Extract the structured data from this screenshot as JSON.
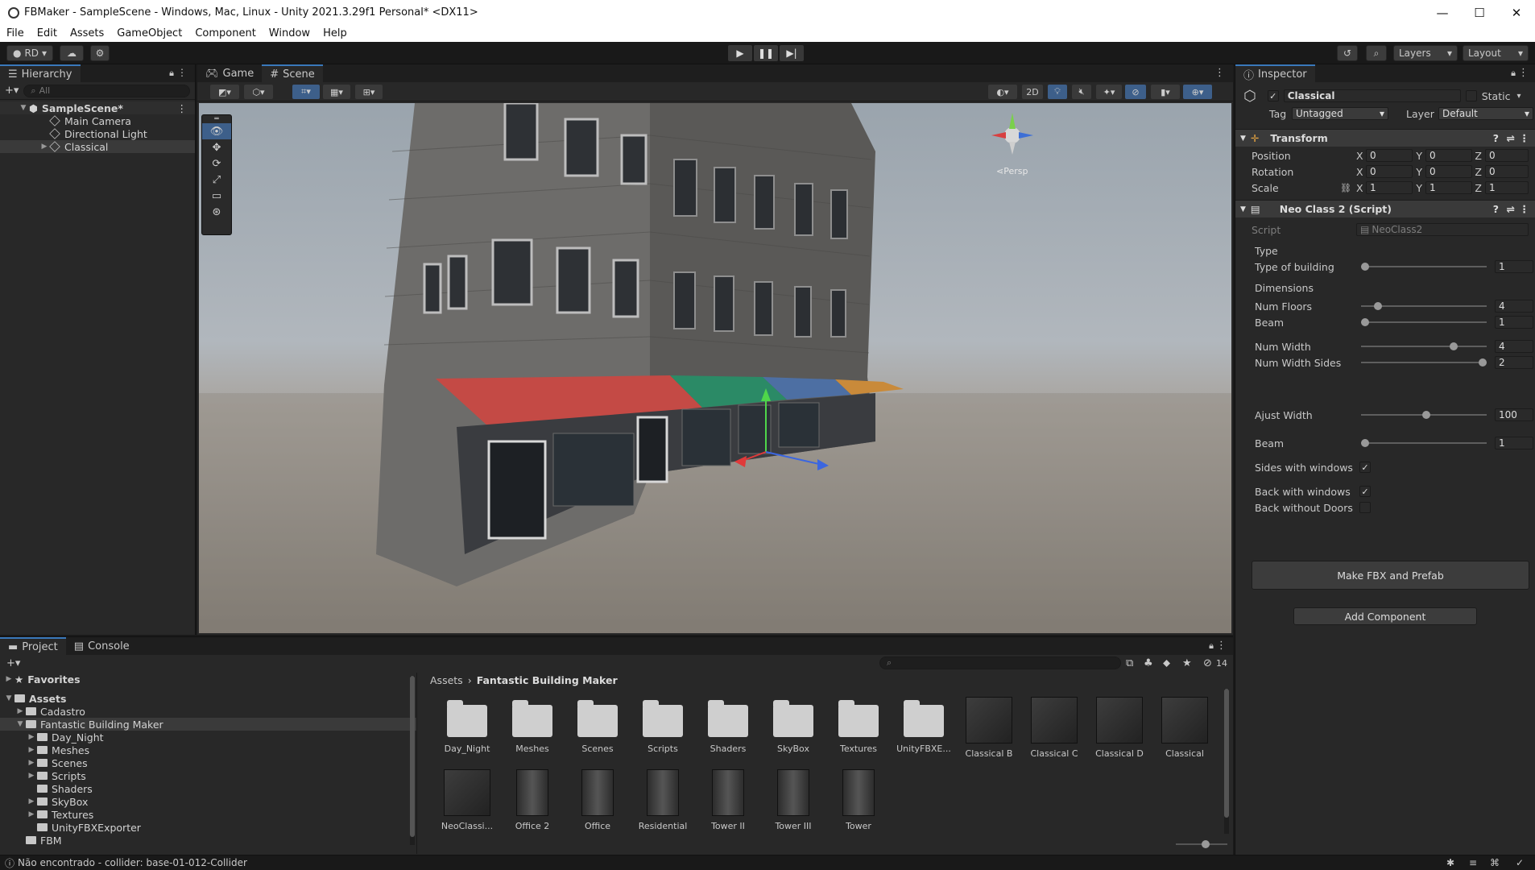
{
  "window": {
    "title": "FBMaker - SampleScene - Windows, Mac, Linux - Unity 2021.3.29f1 Personal* <DX11>"
  },
  "menu": [
    "File",
    "Edit",
    "Assets",
    "GameObject",
    "Component",
    "Window",
    "Help"
  ],
  "toolbar": {
    "account": "RD",
    "layers": "Layers",
    "layout": "Layout"
  },
  "hierarchy": {
    "tab": "Hierarchy",
    "search_placeholder": "All",
    "scene": "SampleScene*",
    "items": [
      "Main Camera",
      "Directional Light",
      "Classical"
    ]
  },
  "scene_tabs": {
    "game": "Game",
    "scene": "Scene",
    "mode_2d": "2D"
  },
  "gizmo": {
    "persp": "Persp"
  },
  "inspector": {
    "tab": "Inspector",
    "object_name": "Classical",
    "static_label": "Static",
    "tag_label": "Tag",
    "tag_value": "Untagged",
    "layer_label": "Layer",
    "layer_value": "Default",
    "transform": {
      "title": "Transform",
      "position_label": "Position",
      "rotation_label": "Rotation",
      "scale_label": "Scale",
      "position": [
        "0",
        "0",
        "0"
      ],
      "rotation": [
        "0",
        "0",
        "0"
      ],
      "scale": [
        "1",
        "1",
        "1"
      ]
    },
    "script_component": {
      "title": "Neo Class 2 (Script)",
      "script_label": "Script",
      "script_value": "NeoClass2",
      "type_header": "Type",
      "type_of_building_label": "Type of building",
      "type_of_building": "1",
      "dimensions_header": "Dimensions",
      "num_floors_label": "Num Floors",
      "num_floors": "4",
      "beam_label": "Beam",
      "beam": "1",
      "num_width_label": "Num Width",
      "num_width": "4",
      "num_width_sides_label": "Num Width Sides",
      "num_width_sides": "2",
      "ajust_width_label": "Ajust Width",
      "ajust_width": "100",
      "beam2_label": "Beam",
      "beam2": "1",
      "sides_with_windows_label": "Sides with windows",
      "back_with_windows_label": "Back with windows",
      "back_without_doors_label": "Back without Doors",
      "make_button": "Make FBX and Prefab"
    },
    "add_component": "Add Component"
  },
  "project": {
    "tab_project": "Project",
    "tab_console": "Console",
    "favorites": "Favorites",
    "assets": "Assets",
    "tree": [
      "Cadastro",
      "Fantastic Building Maker",
      "Day_Night",
      "Meshes",
      "Scenes",
      "Scripts",
      "Shaders",
      "SkyBox",
      "Textures",
      "UnityFBXExporter",
      "FBM"
    ],
    "breadcrumb_root": "Assets",
    "breadcrumb_current": "Fantastic Building Maker",
    "hidden_count": "14",
    "row1": [
      "Day_Night",
      "Meshes",
      "Scenes",
      "Scripts",
      "Shaders",
      "SkyBox",
      "Textures",
      "UnityFBXE...",
      "Classical B",
      "Classical C",
      "Classical D",
      "Classical"
    ],
    "row2": [
      "NeoClassi...",
      "Office 2",
      "Office",
      "Residential",
      "Tower II",
      "Tower III",
      "Tower"
    ]
  },
  "status": {
    "message": "Não encontrado - collider: base-01-012-Collider"
  }
}
